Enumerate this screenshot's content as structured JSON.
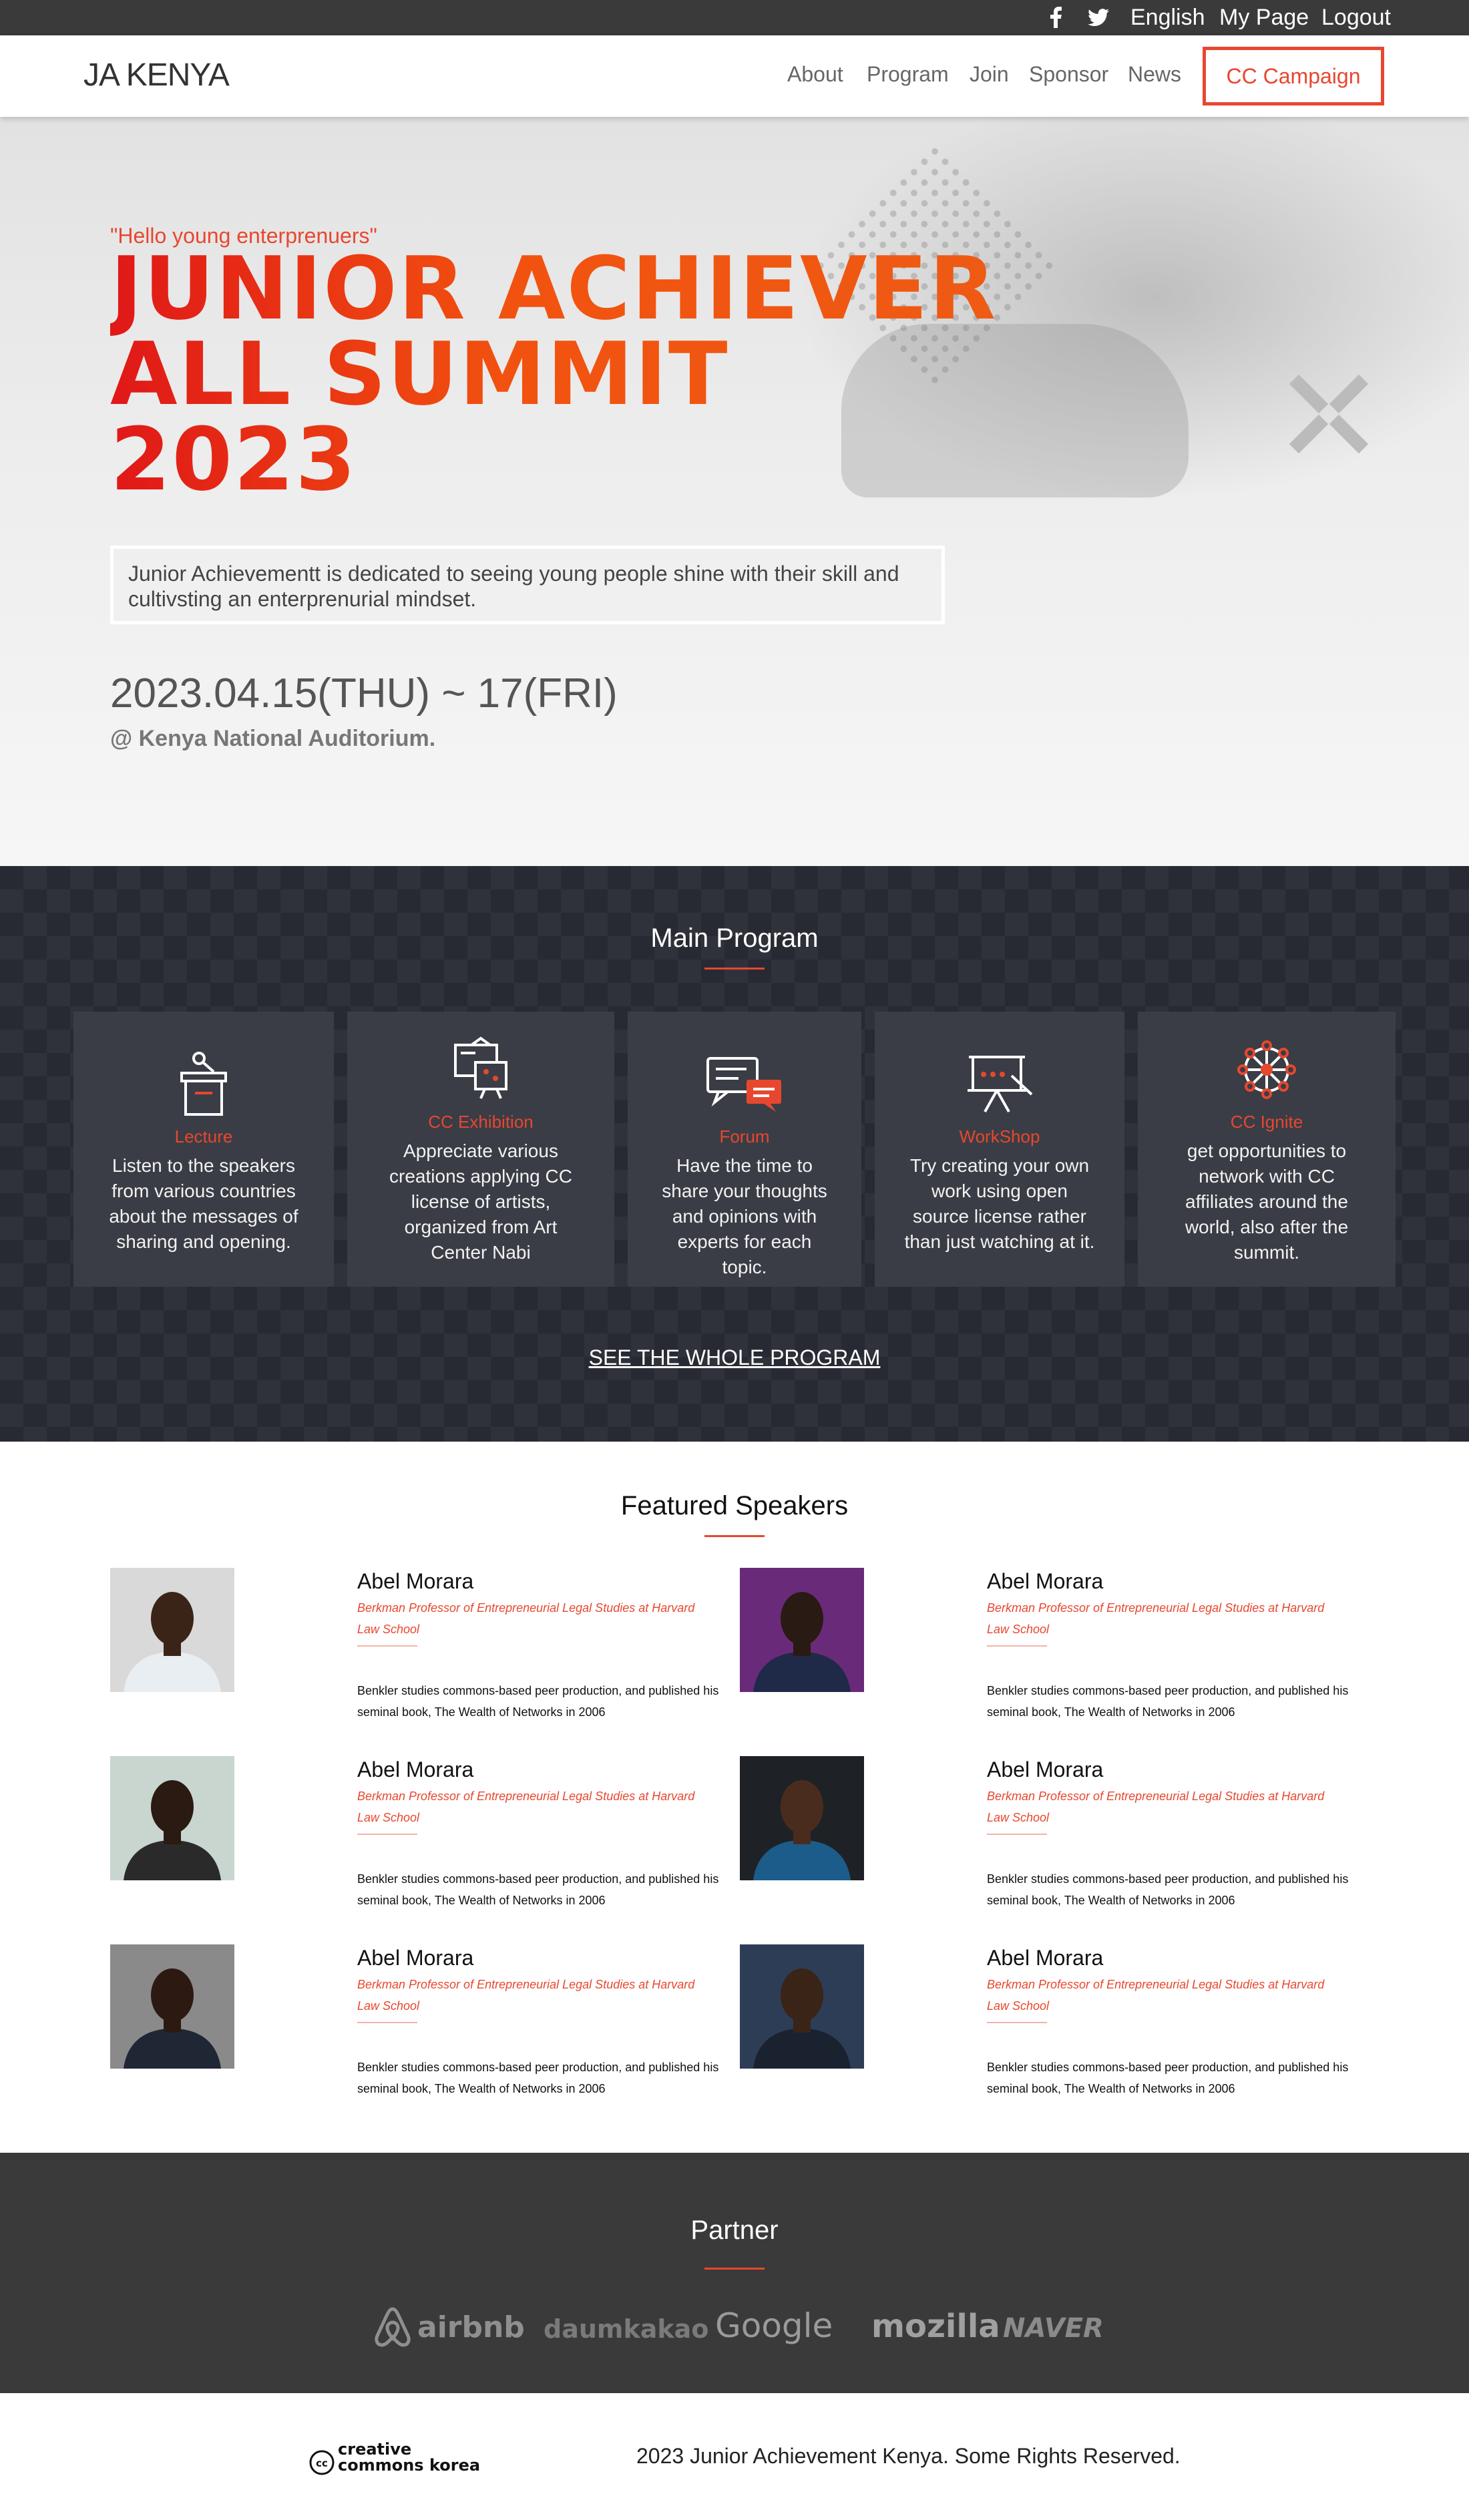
{
  "topbar": {
    "social": [
      "facebook-icon",
      "twitter-icon"
    ],
    "links": [
      "English",
      "My Page",
      "Logout"
    ]
  },
  "nav": {
    "logo": "JA KENYA",
    "links": [
      "About",
      "Program",
      "Join",
      "Sponsor",
      "News"
    ],
    "cta": "CC Campaign"
  },
  "hero": {
    "kicker": "\"Hello young enterprenuers\"",
    "title_lines": [
      "JUNIOR ACHIEVER",
      "ALL SUMMIT",
      "2023"
    ],
    "description": "Junior Achievementt is dedicated to seeing young people shine with their skill and cultivsting an enterprenurial mindset.",
    "dates": "2023.04.15(THU) ~ 17(FRI)",
    "venue": "@ Kenya National Auditorium."
  },
  "program": {
    "title": "Main Program",
    "cards": [
      {
        "icon": "podium-icon",
        "title": "Lecture",
        "text": "Listen to the speakers from various countries about the messages of sharing and opening."
      },
      {
        "icon": "exhibition-icon",
        "title": "CC Exhibition",
        "text": "Appreciate various creations applying CC license of artists, organized from Art Center Nabi"
      },
      {
        "icon": "chat-bubbles-icon",
        "title": "Forum",
        "text": "Have the time to share your thoughts and opinions with experts for each topic."
      },
      {
        "icon": "whiteboard-icon",
        "title": "WorkShop",
        "text": "Try creating your own work using open source license rather than just watching at it."
      },
      {
        "icon": "network-icon",
        "title": "CC Ignite",
        "text": "get opportunities to network with CC affiliates around the world, also after the summit."
      }
    ],
    "see_all": "SEE THE WHOLE PROGRAM"
  },
  "speakers": {
    "title": "Featured Speakers",
    "items": [
      {
        "name": "Abel Morara",
        "role": "Berkman Professor of Entrepreneurial Legal Studies at Harvard Law School",
        "bio": "Benkler studies commons-based peer production, and published his seminal book, The Wealth of Networks in 2006",
        "photo_bg": "#d9d9d9",
        "photo_skin": "#3a2418",
        "photo_shirt": "#e9eef2"
      },
      {
        "name": "Abel Morara",
        "role": "Berkman Professor of Entrepreneurial Legal Studies at Harvard Law School",
        "bio": "Benkler studies commons-based peer production, and published his seminal book, The Wealth of Networks in 2006",
        "photo_bg": "#6a2a7a",
        "photo_skin": "#2a1a14",
        "photo_shirt": "#1f2a48"
      },
      {
        "name": "Abel Morara",
        "role": "Berkman Professor of Entrepreneurial Legal Studies at Harvard Law School",
        "bio": "Benkler studies commons-based peer production, and published his seminal book, The Wealth of Networks in 2006",
        "photo_bg": "#c9d6d0",
        "photo_skin": "#2a1a12",
        "photo_shirt": "#2a2a2a"
      },
      {
        "name": "Abel Morara",
        "role": "Berkman Professor of Entrepreneurial Legal Studies at Harvard Law School",
        "bio": "Benkler studies commons-based peer production, and published his seminal book, The Wealth of Networks in 2006",
        "photo_bg": "#1e2226",
        "photo_skin": "#4a2c1e",
        "photo_shirt": "#1c5c8a"
      },
      {
        "name": "Abel Morara",
        "role": "Berkman Professor of Entrepreneurial Legal Studies at Harvard Law School",
        "bio": "Benkler studies commons-based peer production, and published his seminal book, The Wealth of Networks in 2006",
        "photo_bg": "#8a8a8a",
        "photo_skin": "#2c1a12",
        "photo_shirt": "#1f2735"
      },
      {
        "name": "Abel Morara",
        "role": "Berkman Professor of Entrepreneurial Legal Studies at Harvard Law School",
        "bio": "Benkler studies commons-based peer production, and published his seminal book, The Wealth of Networks in 2006",
        "photo_bg": "#2d3d55",
        "photo_skin": "#3a2418",
        "photo_shirt": "#1a2230"
      }
    ]
  },
  "partner": {
    "title": "Partner",
    "logos": [
      "airbnb",
      "daumkakao",
      "Google",
      "mozilla",
      "NAVER"
    ]
  },
  "footer": {
    "cc_logo": "creative commons korea",
    "copyright": "2023 Junior Achievement Kenya. Some Rights Reserved."
  },
  "colors": {
    "accent": "#e8472f",
    "dark": "#272a33",
    "topbar": "#3a3a3a"
  }
}
